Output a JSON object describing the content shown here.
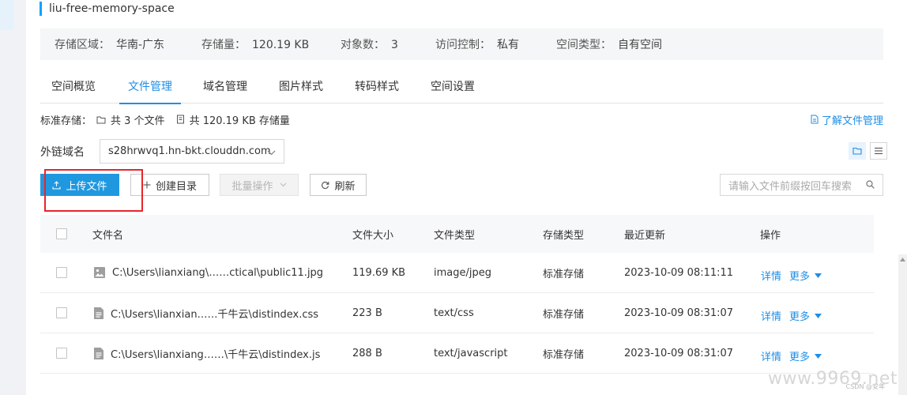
{
  "bucket": {
    "name": "liu-free-memory-space"
  },
  "info": [
    {
      "label": "存储区域：",
      "value": "华南-广东"
    },
    {
      "label": "存储量：",
      "value": "120.19 KB"
    },
    {
      "label": "对象数：",
      "value": "3"
    },
    {
      "label": "访问控制：",
      "value": "私有"
    },
    {
      "label": "空间类型：",
      "value": "自有空间"
    }
  ],
  "tabs": [
    {
      "label": "空间概览",
      "active": false
    },
    {
      "label": "文件管理",
      "active": true
    },
    {
      "label": "域名管理",
      "active": false
    },
    {
      "label": "图片样式",
      "active": false
    },
    {
      "label": "转码样式",
      "active": false
    },
    {
      "label": "空间设置",
      "active": false
    }
  ],
  "summary": {
    "label": "标准存储：",
    "files": "共 3 个文件",
    "size": "共 120.19 KB 存储量"
  },
  "learn_link": "了解文件管理",
  "domain": {
    "label": "外链域名",
    "value": "s28hrwvq1.hn-bkt.clouddn.com"
  },
  "toolbar": {
    "upload": "上传文件",
    "mkdir": "创建目录",
    "batch": "批量操作",
    "refresh": "刷新"
  },
  "search": {
    "placeholder": "请输入文件前缀按回车搜索"
  },
  "table": {
    "headers": {
      "name": "文件名",
      "size": "文件大小",
      "type": "文件类型",
      "storage": "存储类型",
      "updated": "最近更新",
      "ops": "操作"
    },
    "rows": [
      {
        "name": "C:\\Users\\lianxiang\\……ctical\\public11.jpg",
        "icon": "image-file-icon",
        "size": "119.69 KB",
        "type": "image/jpeg",
        "storage": "标准存储",
        "updated": "2023-10-09 08:11:11",
        "detail": "详情",
        "more": "更多"
      },
      {
        "name": "C:\\Users\\lianxian……千牛云\\distindex.css",
        "icon": "document-file-icon",
        "size": "223 B",
        "type": "text/css",
        "storage": "标准存储",
        "updated": "2023-10-09 08:31:07",
        "detail": "详情",
        "more": "更多"
      },
      {
        "name": "C:\\Users\\lianxiang……\\千牛云\\distindex.js",
        "icon": "document-file-icon",
        "size": "288 B",
        "type": "text/javascript",
        "storage": "标准存储",
        "updated": "2023-10-09 08:31:07",
        "detail": "详情",
        "more": "更多"
      }
    ]
  },
  "watermark": {
    "text": "www.9969.net",
    "small": "CSDN @安年"
  },
  "colors": {
    "accent": "#1f8ee6",
    "primary_button": "#1f98e0",
    "highlight": "#e8262a"
  }
}
